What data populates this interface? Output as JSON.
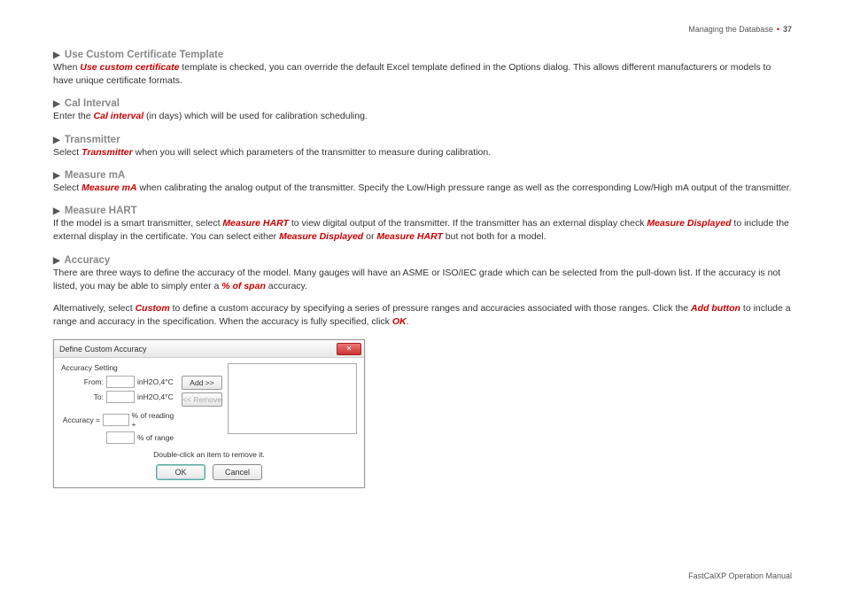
{
  "header": {
    "chapter": "Managing the Database",
    "page": "37"
  },
  "footer": "FastCalXP Operation Manual",
  "sections": {
    "s1": {
      "title": "Use Custom Certificate Template",
      "t1": "When ",
      "em1": "Use custom certificate",
      "t2": " template is checked, you can override the default Excel template defined in the Options dialog. This allows different manufacturers or models to have unique certificate formats."
    },
    "s2": {
      "title": "Cal Interval",
      "t1": "Enter the ",
      "em1": "Cal interval",
      "t2": " (in days) which will be used for calibration scheduling."
    },
    "s3": {
      "title": "Transmitter",
      "t1": " Select ",
      "em1": "Transmitter",
      "t2": " when you will select which parameters of the transmitter to measure during calibration."
    },
    "s4": {
      "title": "Measure mA",
      "t1": "Select ",
      "em1": "Measure mA",
      "t2": " when calibrating the analog output of the transmitter. Specify the Low/High pressure range as well as the corresponding Low/High mA output of the transmitter."
    },
    "s5": {
      "title": "Measure HART",
      "t1": "If the model is a smart transmitter, select ",
      "em1": "Measure HART",
      "t2": " to view digital output of the transmitter. If the transmitter has an external display check ",
      "em2": "Measure Displayed",
      "t3": " to include the external display in the certificate. You can select either ",
      "em3": "Measure Displayed",
      "t4": " or ",
      "em4": "Measure HART",
      "t5": " but not both for a model."
    },
    "s6": {
      "title": "Accuracy",
      "p1a": "There are three ways to define the accuracy of the model. Many gauges will have an ASME or ISO/IEC grade which can be selected from the pull-down list. If the accuracy is not listed, you may be able to simply enter a ",
      "p1em": "% of span",
      "p1b": " accuracy.",
      "p2a": "Alternatively, select ",
      "p2em1": "Custom",
      "p2b": " to define a custom accuracy by specifying a series of pressure ranges and accuracies associated with those ranges. Click the ",
      "p2em2": "Add button",
      "p2c": " to include a range and accuracy in the specification. When the accuracy is fully specified, click ",
      "p2em3": "OK",
      "p2d": "."
    }
  },
  "dialog": {
    "title": "Define Custom Accuracy",
    "group": "Accuracy Setting",
    "from": "From:",
    "to": "To:",
    "unit": "inH2O,4°C",
    "accuracy": "Accuracy =",
    "reading": "% of reading +",
    "range": "% of range",
    "add": "Add >>",
    "remove": "<< Remove",
    "caption": "Double-click an item to remove it.",
    "ok": "OK",
    "cancel": "Cancel"
  }
}
